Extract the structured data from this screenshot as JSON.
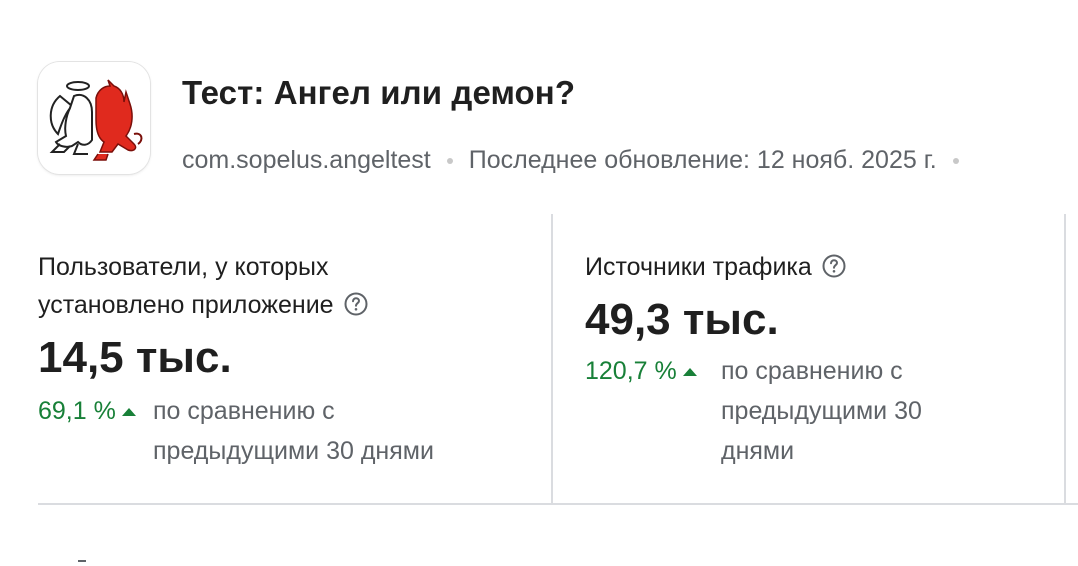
{
  "app": {
    "title": "Тест: Ангел или демон?",
    "icon": "angel-demon-app-icon",
    "package": "com.sopelus.angeltest",
    "last_update": "Последнее обновление: 12 нояб. 2025 г."
  },
  "cards": [
    {
      "label": "Пользователи, у которых установлено приложение",
      "help_icon": "help-circle-icon",
      "value": "14,5 тыс.",
      "delta": "69,1 %",
      "delta_direction": "up",
      "compare": "по сравнению с предыдущими 30 днями"
    },
    {
      "label": "Источники трафика",
      "help_icon": "help-circle-icon",
      "value": "49,3 тыс.",
      "delta": "120,7 %",
      "delta_direction": "up",
      "compare": "по сравнению с предыдущими 30 днями"
    }
  ],
  "colors": {
    "positive": "#188038",
    "secondary_text": "#5f6368",
    "primary_text": "#1f1f1f",
    "divider": "#dadce0",
    "demon_red": "#e02a1e"
  }
}
